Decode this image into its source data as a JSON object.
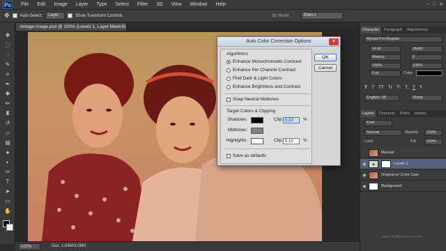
{
  "app": {
    "logo": "Ps",
    "menu": [
      "File",
      "Edit",
      "Image",
      "Layer",
      "Type",
      "Select",
      "Filter",
      "3D",
      "View",
      "Window",
      "Help"
    ],
    "window_controls": [
      "–",
      "□",
      "✕"
    ]
  },
  "options_bar": {
    "auto_select_label": "Auto-Select:",
    "auto_select_value": "Layer",
    "transform_label": "Show Transform Controls",
    "mode_3d": "3D Mode:",
    "workspace": "Ellen's"
  },
  "document": {
    "tab_title": "vintage-image.psd @ 100% (Levels 1, Layer Mask/8) *",
    "zoom": "100%",
    "doc_info": "Doc: 1.54M/3.08M"
  },
  "dialog": {
    "title": "Auto Color Correction Options",
    "algorithms_label": "Algorithms",
    "algorithms": [
      {
        "label": "Enhance Monochromatic Contrast",
        "selected": true
      },
      {
        "label": "Enhance Per Channel Contrast",
        "selected": false
      },
      {
        "label": "Find Dark & Light Colors",
        "selected": false
      },
      {
        "label": "Enhance Brightness and Contrast",
        "selected": false
      }
    ],
    "snap_label": "Snap Neutral Midtones",
    "target_label": "Target Colors & Clipping",
    "shadows_label": "Shadows:",
    "midtones_label": "Midtones:",
    "highlights_label": "Highlights:",
    "clip_label": "Clip:",
    "shadows_clip": "0.10",
    "highlights_clip": "0.10",
    "percent": "%",
    "save_defaults_label": "Save as defaults",
    "ok_label": "OK",
    "cancel_label": "Cancel",
    "colors": {
      "shadows": "#000000",
      "midtones": "#808080",
      "highlights": "#ffffff"
    }
  },
  "character_panel": {
    "tabs": [
      "Character",
      "Paragraph",
      "Adjustments"
    ],
    "font": "Myriad Pro Regular",
    "size": "14 pt",
    "leading": "(Auto)",
    "kerning": "Metrics",
    "tracking": "0",
    "scale_v": "100%",
    "scale_h": "100%",
    "baseline": "0 pt",
    "color_label": "Color:",
    "type_styles": [
      "T",
      "T",
      "TT",
      "Tr",
      "T¹",
      "T,",
      "T",
      "Ŧ"
    ],
    "language": "English: UK",
    "aa": "Sharp"
  },
  "layers_panel": {
    "tabs": [
      "Layers",
      "Channels",
      "Paths",
      "History"
    ],
    "kind": "Kind",
    "blend": "Normal",
    "opacity_label": "Opacity:",
    "opacity": "100%",
    "lock_label": "Lock:",
    "fill_label": "Fill:",
    "fill": "100%",
    "layers": [
      {
        "name": "Manual",
        "visible": false,
        "selected": false,
        "thumb": "photo"
      },
      {
        "name": "Levels 1",
        "visible": true,
        "selected": true,
        "thumb": "adj"
      },
      {
        "name": "Original w/ Color Cast",
        "visible": true,
        "selected": false,
        "thumb": "photo"
      },
      {
        "name": "Background",
        "visible": true,
        "selected": false,
        "thumb": "white"
      }
    ]
  },
  "watermark": "www.3rdElement.com"
}
